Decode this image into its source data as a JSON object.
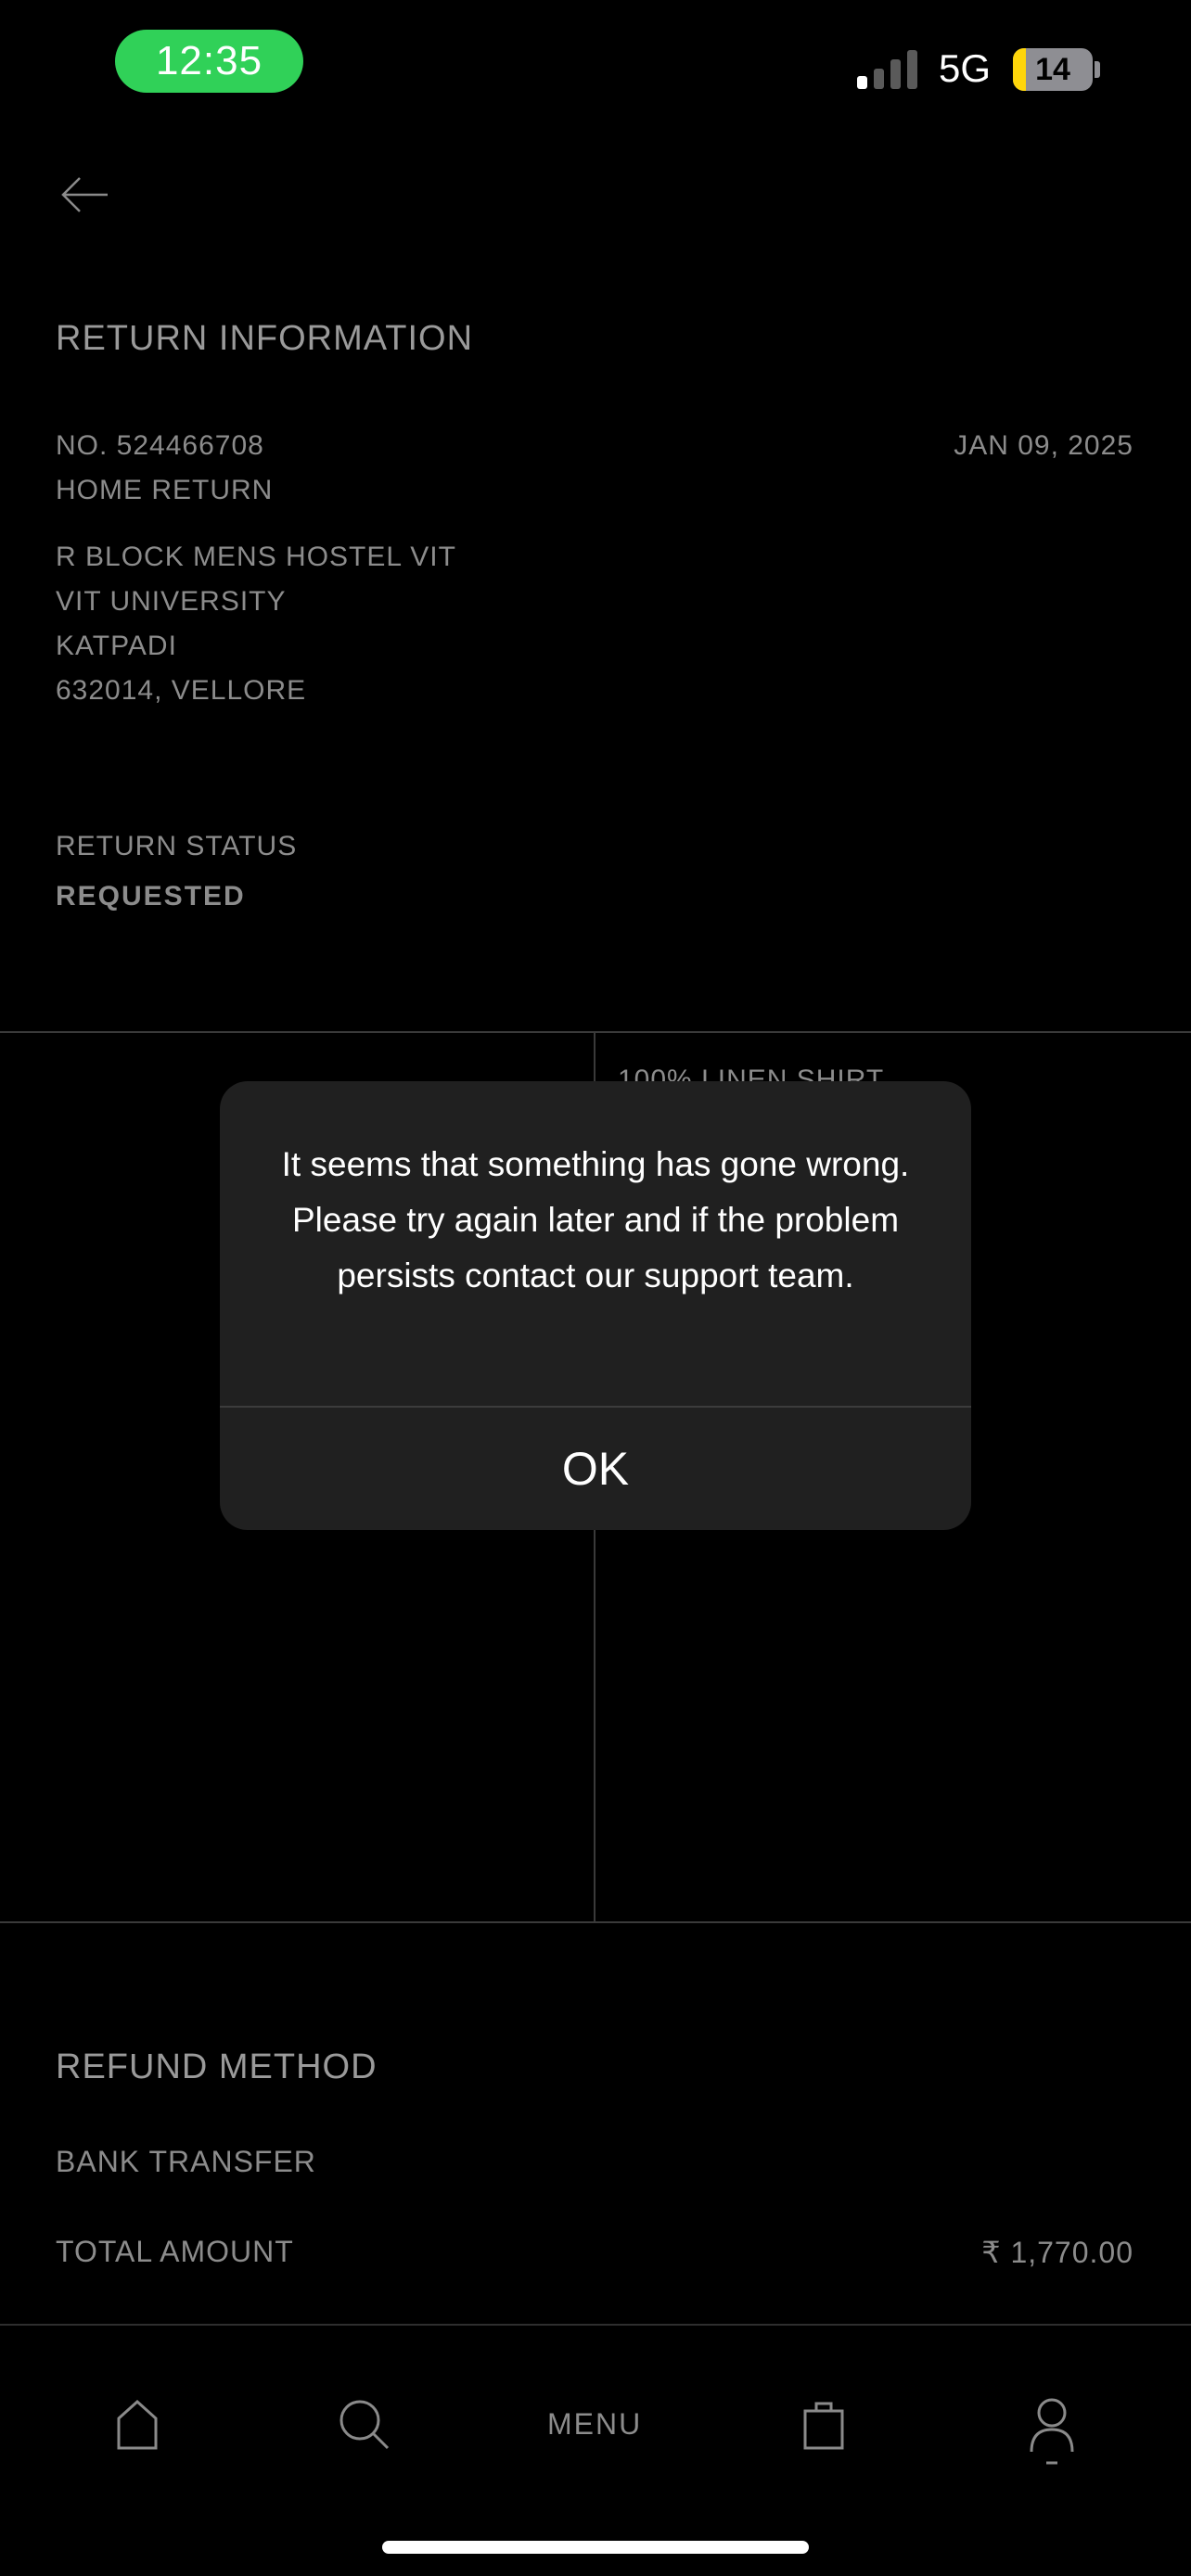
{
  "status_bar": {
    "time": "12:35",
    "network": "5G",
    "battery": "14"
  },
  "header": {
    "title": "RETURN INFORMATION"
  },
  "return": {
    "number": "NO. 524466708",
    "date": "JAN 09, 2025",
    "type": "HOME RETURN",
    "address": [
      "R BLOCK MENS HOSTEL VIT",
      "VIT UNIVERSITY",
      "KATPADI",
      "632014, VELLORE"
    ],
    "status_label": "RETURN STATUS",
    "status_value": "REQUESTED"
  },
  "item": {
    "name": "100% LINEN SHIRT"
  },
  "refund": {
    "title": "REFUND METHOD",
    "method": "BANK TRANSFER",
    "total_label": "TOTAL AMOUNT",
    "total_value": "₹ 1,770.00"
  },
  "dialog": {
    "message": "It seems that something has gone wrong. Please try again later and if the problem persists contact our support team.",
    "ok_label": "OK"
  },
  "nav": {
    "menu_label": "MENU"
  },
  "colors": {
    "accent_time": "#30d158",
    "battery_fill": "#ffd60a",
    "background": "#000000"
  }
}
